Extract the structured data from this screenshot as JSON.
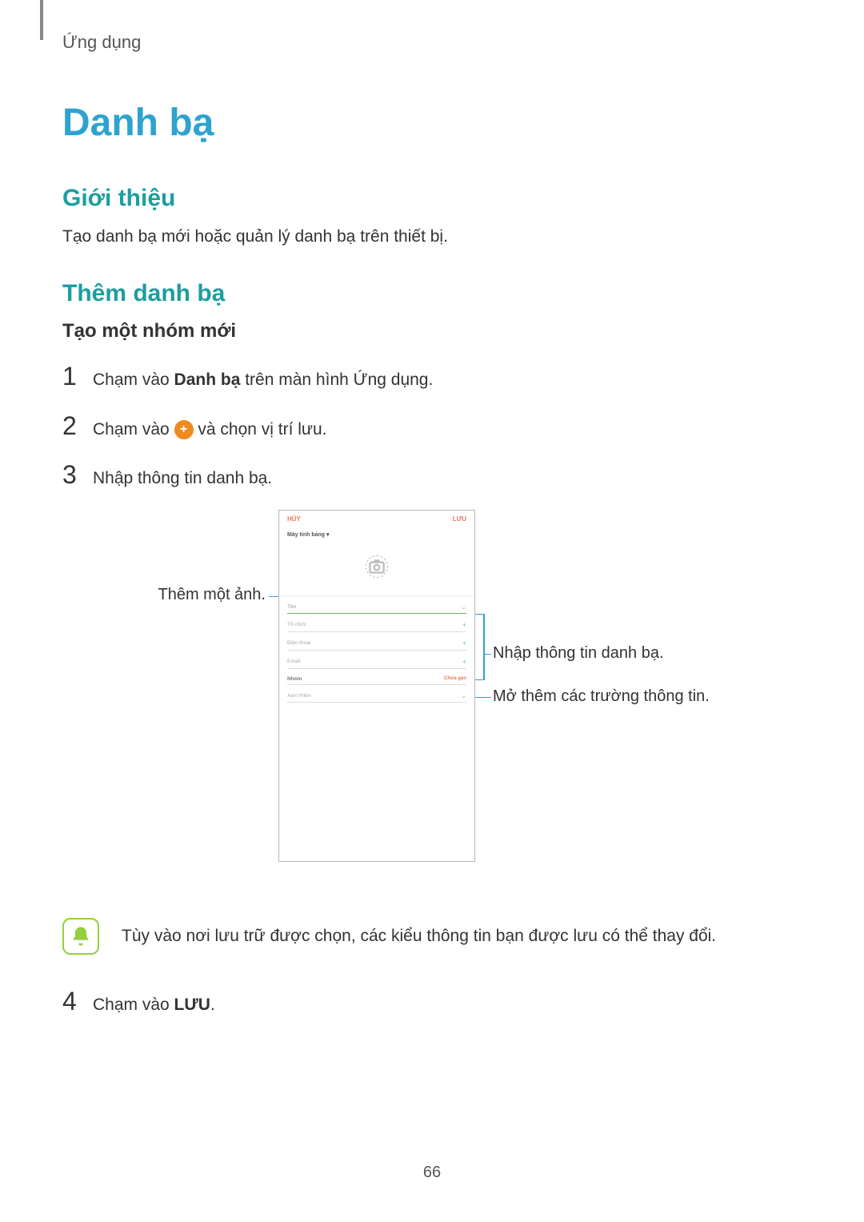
{
  "breadcrumb": "Ứng dụng",
  "section_title": "Danh bạ",
  "intro_heading": "Giới thiệu",
  "intro_text": "Tạo danh bạ mới hoặc quản lý danh bạ trên thiết bị.",
  "add_heading": "Thêm danh bạ",
  "sub_heading": "Tạo một nhóm mới",
  "steps": {
    "s1_pre": "Chạm vào ",
    "s1_bold": "Danh bạ",
    "s1_post": " trên màn hình Ứng dụng.",
    "s2_pre": "Chạm vào ",
    "s2_post": " và chọn vị trí lưu.",
    "s3": "Nhập thông tin danh bạ.",
    "s4_pre": "Chạm vào ",
    "s4_bold": "LƯU",
    "s4_post": "."
  },
  "callouts": {
    "left": "Thêm một ảnh.",
    "right1": "Nhập thông tin danh bạ.",
    "right2": "Mở thêm các trường thông tin."
  },
  "mock": {
    "cancel": "HỦY",
    "save": "LƯU",
    "dropdown": "Máy tính bảng",
    "f_name": "Tên",
    "f_org": "Tổ chức",
    "f_phone": "Điện thoại",
    "f_email": "Email",
    "f_group": "Nhóm",
    "f_group_val": "Chưa gán",
    "f_more": "Xem thêm"
  },
  "note_text": "Tùy vào nơi lưu trữ được chọn, các kiểu thông tin bạn được lưu có thể thay đổi.",
  "page_number": "66"
}
